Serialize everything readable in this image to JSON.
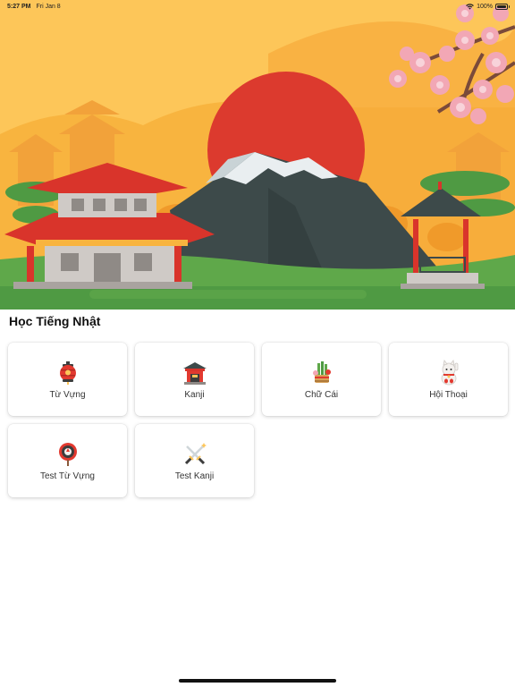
{
  "status_bar": {
    "time": "5:27 PM",
    "date": "Fri Jan 8",
    "battery_text": "100%",
    "battery_level": 1.0
  },
  "hero": {
    "colors": {
      "sky": "#fdc659",
      "sun": "#dc3a2e",
      "mountain": "#3d4a4a",
      "snow": "#e9eef0",
      "grass": "#5fa84a",
      "roof_red": "#d9342b",
      "blossom": "#f2a7b5"
    }
  },
  "section_title": "Học Tiếng Nhật",
  "tiles": [
    {
      "label": "Từ Vựng",
      "icon": "lantern-icon"
    },
    {
      "label": "Kanji",
      "icon": "shrine-icon"
    },
    {
      "label": "Chữ Cái",
      "icon": "kadomatsu-icon"
    },
    {
      "label": "Hội Thoại",
      "icon": "maneki-neko-icon"
    },
    {
      "label": "Test Từ Vựng",
      "icon": "paper-fan-icon"
    },
    {
      "label": "Test Kanji",
      "icon": "katana-icon"
    }
  ]
}
